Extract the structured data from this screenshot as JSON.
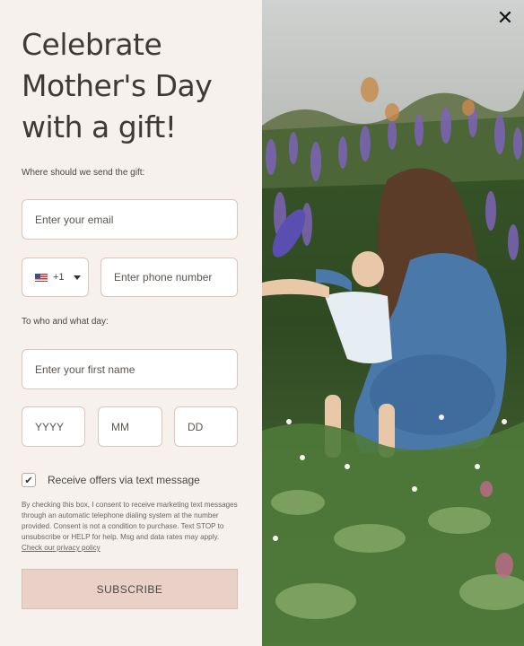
{
  "popup": {
    "title_lines": [
      "Celebrate",
      "Mother's Day",
      "with a gift!"
    ],
    "email_prompt": "Where should we send the gift:",
    "email_placeholder": "Enter your email",
    "country_code": "+1",
    "country_flag": "us-flag-icon",
    "phone_placeholder": "Enter phone number",
    "recipient_prompt": "To who and what day:",
    "first_name_placeholder": "Enter your first name",
    "year_placeholder": "YYYY",
    "month_placeholder": "MM",
    "day_placeholder": "DD",
    "checkbox_checked": true,
    "checkbox_label": "Receive offers via text message",
    "legal_text": "By checking this box, I consent to receive marketing text messages through an automatic telephone dialing system at the number provided. Consent is not a condition to purchase. Text STOP to unsubscribe or HELP for help. Msg and data rates may apply.",
    "privacy_link": "Check our privacy policy",
    "subscribe_label": "SUBSCRIBE",
    "close_icon": "close-icon"
  },
  "colors": {
    "panel_bg": "#f6f1ed",
    "field_border": "#dcc5bb",
    "button_bg": "#e9d1c8",
    "text": "#3e3a36"
  }
}
